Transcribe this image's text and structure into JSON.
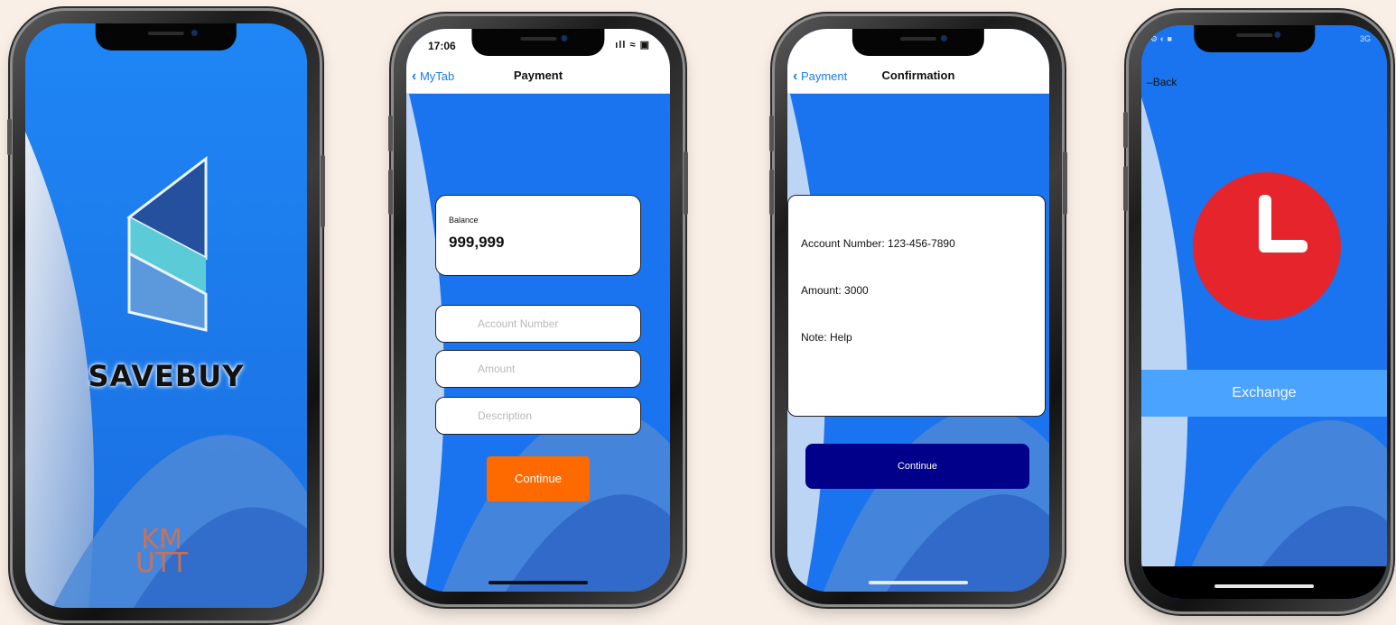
{
  "phone1": {
    "brand": "SAVEBUY",
    "logo_text_1": "KM",
    "logo_text_2": "UTT"
  },
  "phone2": {
    "status_time": "17:06",
    "status_icons": "ıll ≈ ▣",
    "nav_back": "MyTab",
    "nav_title": "Payment",
    "balance_label": "Balance",
    "balance_value": "999,999",
    "account_placeholder": "Account Number",
    "amount_placeholder": "Amount",
    "description_placeholder": "Description",
    "continue_label": "Continue",
    "continue_color": "#ff6a00"
  },
  "phone3": {
    "nav_back": "Payment",
    "nav_title": "Confirmation",
    "account_line": "Account Number: 123-456-7890",
    "amount_line": "Amount: 3000",
    "note_line": "Note: Help",
    "continue_label": "Continue",
    "continue_color": "#00008a"
  },
  "phone4": {
    "status_left": "⚙ ◐ ■",
    "status_right": "3G",
    "back_label": "Back",
    "exchange_label": "Exchange",
    "clock_color": "#e5242c",
    "exchange_color": "#4aa3ff"
  }
}
